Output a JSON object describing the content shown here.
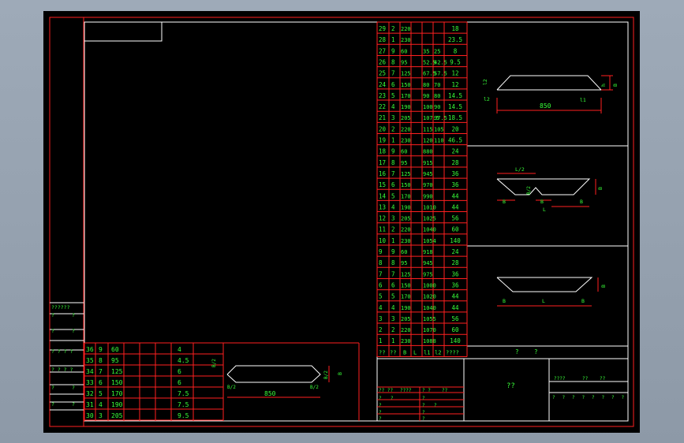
{
  "colors": {
    "frame": "#ff2020",
    "text": "#39ff39",
    "white": "#ffffff",
    "bg": "#000000"
  },
  "bottom_table": {
    "rows": [
      {
        "n": "36",
        "a": "9",
        "b": "60",
        "v": "4"
      },
      {
        "n": "35",
        "a": "8",
        "b": "95",
        "v": "4.5"
      },
      {
        "n": "34",
        "a": "7",
        "b": "125",
        "v": "6"
      },
      {
        "n": "33",
        "a": "6",
        "b": "150",
        "v": "6"
      },
      {
        "n": "32",
        "a": "5",
        "b": "170",
        "v": "7.5"
      },
      {
        "n": "31",
        "a": "4",
        "b": "190",
        "v": "7.5"
      },
      {
        "n": "30",
        "a": "3",
        "b": "205",
        "v": "9.5"
      }
    ]
  },
  "right_table": {
    "rows": [
      {
        "n": "29",
        "a": "2",
        "b": "220",
        "c": "",
        "d": "",
        "v": "18"
      },
      {
        "n": "28",
        "a": "1",
        "b": "230",
        "c": "",
        "d": "",
        "v": "23.5"
      },
      {
        "n": "27",
        "a": "9",
        "b": "60",
        "c": "35",
        "d": "25",
        "v": "8"
      },
      {
        "n": "26",
        "a": "8",
        "b": "95",
        "c": "52.5",
        "d": "42.5",
        "v": "9.5"
      },
      {
        "n": "25",
        "a": "7",
        "b": "125",
        "c": "67.5",
        "d": "57.5",
        "v": "12"
      },
      {
        "n": "24",
        "a": "6",
        "b": "150",
        "c": "80",
        "d": "70",
        "v": "12"
      },
      {
        "n": "23",
        "a": "5",
        "b": "170",
        "c": "90",
        "d": "80",
        "v": "14.5"
      },
      {
        "n": "22",
        "a": "4",
        "b": "190",
        "c": "100",
        "d": "90",
        "v": "14.5"
      },
      {
        "n": "21",
        "a": "3",
        "b": "205",
        "c": "107.5",
        "d": "97.5",
        "v": "18.5"
      },
      {
        "n": "20",
        "a": "2",
        "b": "220",
        "c": "115",
        "d": "105",
        "v": "20"
      },
      {
        "n": "19",
        "a": "1",
        "b": "230",
        "c": "120",
        "d": "110",
        "v": "46.5"
      },
      {
        "n": "18",
        "a": "9",
        "b": "60",
        "c": "880",
        "d": "",
        "v": "24"
      },
      {
        "n": "17",
        "a": "8",
        "b": "95",
        "c": "915",
        "d": "",
        "v": "28"
      },
      {
        "n": "16",
        "a": "7",
        "b": "125",
        "c": "945",
        "d": "",
        "v": "36"
      },
      {
        "n": "15",
        "a": "6",
        "b": "150",
        "c": "970",
        "d": "",
        "v": "36"
      },
      {
        "n": "14",
        "a": "5",
        "b": "170",
        "c": "990",
        "d": "",
        "v": "44"
      },
      {
        "n": "13",
        "a": "4",
        "b": "190",
        "c": "1010",
        "d": "",
        "v": "44"
      },
      {
        "n": "12",
        "a": "3",
        "b": "205",
        "c": "1025",
        "d": "",
        "v": "56"
      },
      {
        "n": "11",
        "a": "2",
        "b": "220",
        "c": "1040",
        "d": "",
        "v": "60"
      },
      {
        "n": "10",
        "a": "1",
        "b": "230",
        "c": "1054",
        "d": "",
        "v": "140"
      },
      {
        "n": "9",
        "a": "9",
        "b": "60",
        "c": "918",
        "d": "",
        "v": "24"
      },
      {
        "n": "8",
        "a": "8",
        "b": "95",
        "c": "945",
        "d": "",
        "v": "28"
      },
      {
        "n": "7",
        "a": "7",
        "b": "125",
        "c": "975",
        "d": "",
        "v": "36"
      },
      {
        "n": "6",
        "a": "6",
        "b": "150",
        "c": "1000",
        "d": "",
        "v": "36"
      },
      {
        "n": "5",
        "a": "5",
        "b": "170",
        "c": "1020",
        "d": "",
        "v": "44"
      },
      {
        "n": "4",
        "a": "4",
        "b": "190",
        "c": "1040",
        "d": "",
        "v": "44"
      },
      {
        "n": "3",
        "a": "3",
        "b": "205",
        "c": "1055",
        "d": "",
        "v": "56"
      },
      {
        "n": "2",
        "a": "2",
        "b": "220",
        "c": "1070",
        "d": "",
        "v": "60"
      },
      {
        "n": "1",
        "a": "1",
        "b": "230",
        "c": "1088",
        "d": "",
        "v": "140"
      }
    ],
    "header": [
      "??",
      "??",
      "B",
      "L",
      "l1",
      "l2",
      "????"
    ]
  },
  "right_labels": {
    "bar": [
      "?",
      "?"
    ]
  },
  "left_strip": [
    "??????",
    "?",
    "?",
    "?",
    "?",
    "? ? ? ?",
    "? ? ? ?",
    "?",
    "?",
    "?",
    "?"
  ],
  "title_block": {
    "main": "??",
    "row1": [
      "?? ??",
      "????",
      "? ?",
      "??"
    ],
    "cells": [
      "?",
      "?",
      "?",
      "?",
      "?",
      "?",
      "?",
      "?",
      "?",
      "?",
      "?",
      "?",
      "?",
      "?",
      "?",
      "?",
      "?",
      "?",
      "?",
      "?"
    ],
    "right_top": [
      "????",
      "??",
      "??"
    ],
    "right_row": [
      "?",
      "?",
      "?",
      "?",
      "?",
      "?",
      "?",
      "?"
    ]
  },
  "drawings": {
    "top": {
      "dim_len": "850",
      "dim_h": "h",
      "dim_b": "B",
      "dim_l2": "l2",
      "dim_l1": "l1",
      "left_h": "l2"
    },
    "middle": {
      "dim_top": "L/2",
      "dim_mid": "B/2",
      "b1": "B",
      "b2": "B",
      "b3": "B",
      "L": "L",
      "h": "B"
    },
    "lower": {
      "b1": "B",
      "b2": "B",
      "L": "L",
      "h": "B"
    },
    "bottom": {
      "dim_len": "850",
      "left": "B/2",
      "right": "B/2",
      "h1": "B/2",
      "h2": "B/2",
      "B": "B"
    }
  }
}
